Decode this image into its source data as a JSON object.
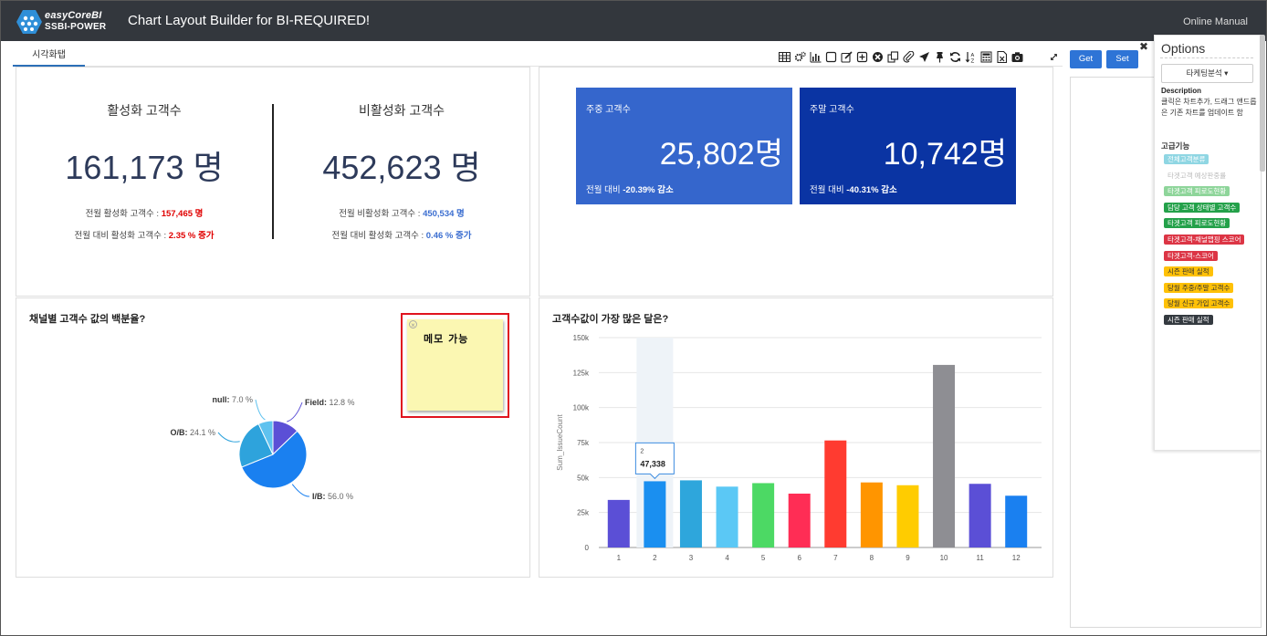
{
  "header": {
    "logo_line1": "easyCoreBI",
    "logo_line2": "SSBI-POWER",
    "title": "Chart Layout Builder for BI-REQUIRED!",
    "online_manual": "Online Manual"
  },
  "tab": {
    "label": "시각화탭"
  },
  "toolbar_icons": [
    "table-icon",
    "gears-icon",
    "bar-chart-icon",
    "square-icon",
    "edit-icon",
    "plus-square-icon",
    "times-circle-icon",
    "clone-icon",
    "paperclip-icon",
    "send-icon",
    "pin-icon",
    "refresh-icon",
    "sort-icon",
    "calculator-icon",
    "excel-icon",
    "camera-icon"
  ],
  "kpi_left": {
    "title": "활성화 고객수",
    "value": "161,173 명",
    "line1_label": "전월 활성화 고객수 : ",
    "line1_value": "157,465 명",
    "line2_label": "전월 대비 활성화 고객수 : ",
    "line2_value": "2.35 % 증가"
  },
  "kpi_right": {
    "title": "비활성화 고객수",
    "value": "452,623 명",
    "line1_label": "전월 비활성화 고객수 : ",
    "line1_value": "450,534 명",
    "line2_label": "전월 대비 활성화 고객수 : ",
    "line2_value": "0.46 % 증가"
  },
  "cards": [
    {
      "title": "주중 고객수",
      "value": "25,802명",
      "foot_label": "전월 대비 ",
      "foot_value": "-20.39% 감소",
      "color": "#3566cc"
    },
    {
      "title": "주말 고객수",
      "value": "10,742명",
      "foot_label": "전월 대비 ",
      "foot_value": "-40.31% 감소",
      "color": "#0a34a3"
    }
  ],
  "pie_panel": {
    "title": "채널별 고객수 값의 백분율?"
  },
  "memo": {
    "text": "메모 가능"
  },
  "bar_panel": {
    "title": "고객수값이 가장 많은 달은?"
  },
  "tooltip": {
    "category": "2",
    "value": "47,338"
  },
  "chart_data": [
    {
      "type": "pie",
      "title": "채널별 고객수 값의 백분율?",
      "slices": [
        {
          "label": "Field",
          "value": 12.8,
          "color": "#5b4fd6"
        },
        {
          "label": "I/B",
          "value": 56.0,
          "color": "#1a80f0"
        },
        {
          "label": "O/B",
          "value": 24.1,
          "color": "#2ea3dc"
        },
        {
          "label": "null",
          "value": 7.0,
          "color": "#5fc2ef"
        }
      ]
    },
    {
      "type": "bar",
      "title": "고객수값이 가장 많은 달은?",
      "ylabel": "Sum_IssueCount",
      "ylim": [
        0,
        150000
      ],
      "yticks": [
        "0",
        "25k",
        "50k",
        "75k",
        "100k",
        "125k",
        "150k"
      ],
      "categories": [
        "1",
        "2",
        "3",
        "4",
        "5",
        "6",
        "7",
        "8",
        "9",
        "10",
        "11",
        "12"
      ],
      "values": [
        34000,
        47338,
        48000,
        43500,
        46000,
        38500,
        76500,
        46500,
        44500,
        130500,
        45500,
        37000
      ],
      "colors": [
        "#5b4fd6",
        "#1a8ff0",
        "#2ea6dc",
        "#5bc8f5",
        "#4cd964",
        "#ff2d55",
        "#ff3b30",
        "#ff9500",
        "#ffcc00",
        "#8e8e93",
        "#5b4fd6",
        "#1a80f0"
      ],
      "highlight_category": "2"
    }
  ],
  "right": {
    "get_label": "Get",
    "set_label": "Set"
  },
  "options": {
    "title": "Options",
    "select_label": "타케팅분석",
    "desc_header": "Description",
    "desc_text": "클릭은 차트추가, 드래그 앤드롭은 기존 차트를 업데이트 함",
    "advanced_label": "고급기능",
    "tags": [
      {
        "label": "전체고객분류",
        "bg": "#8fd6e3",
        "fg": "#ffffff"
      },
      {
        "label": "타겟고객 예상판중률",
        "bg": "#ffffff",
        "fg": "#bbbbbb"
      },
      {
        "label": "타겟고객 피로도현황",
        "bg": "#8ed59a",
        "fg": "#ffffff"
      },
      {
        "label": "담당 고객 상태별 고객수",
        "bg": "#24a14a",
        "fg": "#ffffff"
      },
      {
        "label": "타겟고객 피로도현황",
        "bg": "#24a14a",
        "fg": "#ffffff"
      },
      {
        "label": "타겟고객-채널맵핑 스코어",
        "bg": "#dc3545",
        "fg": "#ffffff"
      },
      {
        "label": "타겟고객-스코어",
        "bg": "#dc3545",
        "fg": "#ffffff"
      },
      {
        "label": "시즌 판매 실적",
        "bg": "#ffc107",
        "fg": "#333333"
      },
      {
        "label": "당월 주중/주말 고객수",
        "bg": "#ffc107",
        "fg": "#333333"
      },
      {
        "label": "당월 신규 가입 고객수",
        "bg": "#ffc107",
        "fg": "#333333"
      },
      {
        "label": "시즌 판매 실적",
        "bg": "#343a40",
        "fg": "#ffffff"
      }
    ]
  }
}
